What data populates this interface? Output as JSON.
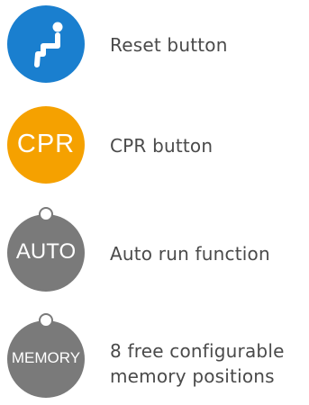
{
  "items": [
    {
      "button_label": "",
      "icon": "seat-recline-icon",
      "color": "#1a7fcf",
      "description": "Reset button"
    },
    {
      "button_label": "CPR",
      "icon": "",
      "color": "#f5a100",
      "description": "CPR button"
    },
    {
      "button_label": "AUTO",
      "icon": "",
      "color": "#7a7a7a",
      "description": "Auto run function"
    },
    {
      "button_label": "MEMORY",
      "icon": "",
      "color": "#7a7a7a",
      "description_lines": [
        "8 free configurable",
        "memory positions"
      ]
    }
  ]
}
